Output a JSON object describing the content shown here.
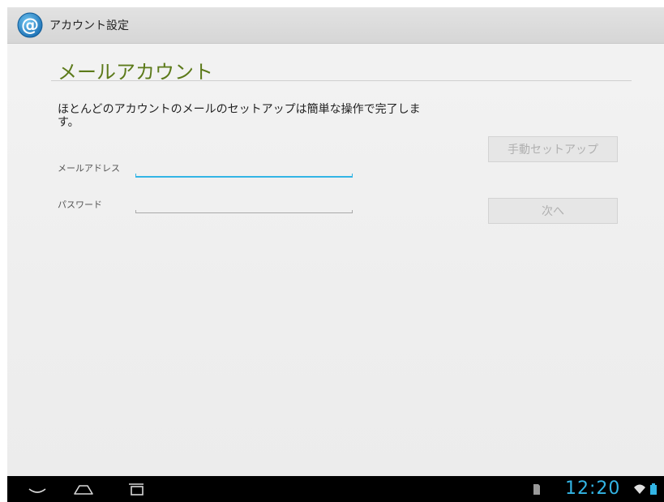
{
  "action_bar": {
    "title": "アカウント設定",
    "icon": "at-sign-icon"
  },
  "screen": {
    "heading": "メールアカウント",
    "instructions": "ほとんどのアカウントのメールのセットアップは簡単な操作で完了します。"
  },
  "form": {
    "email_label": "メールアドレス",
    "email_value": "",
    "password_label": "パスワード",
    "password_value": ""
  },
  "buttons": {
    "manual_setup": "手動セットアップ",
    "next": "次へ"
  },
  "system_bar": {
    "clock": "12:20",
    "icons": [
      "back-icon",
      "home-icon",
      "recent-apps-icon",
      "sd-card-icon",
      "wifi-icon",
      "battery-icon"
    ]
  },
  "colors": {
    "accent": "#33b5e5",
    "heading": "#5c7a1a"
  }
}
